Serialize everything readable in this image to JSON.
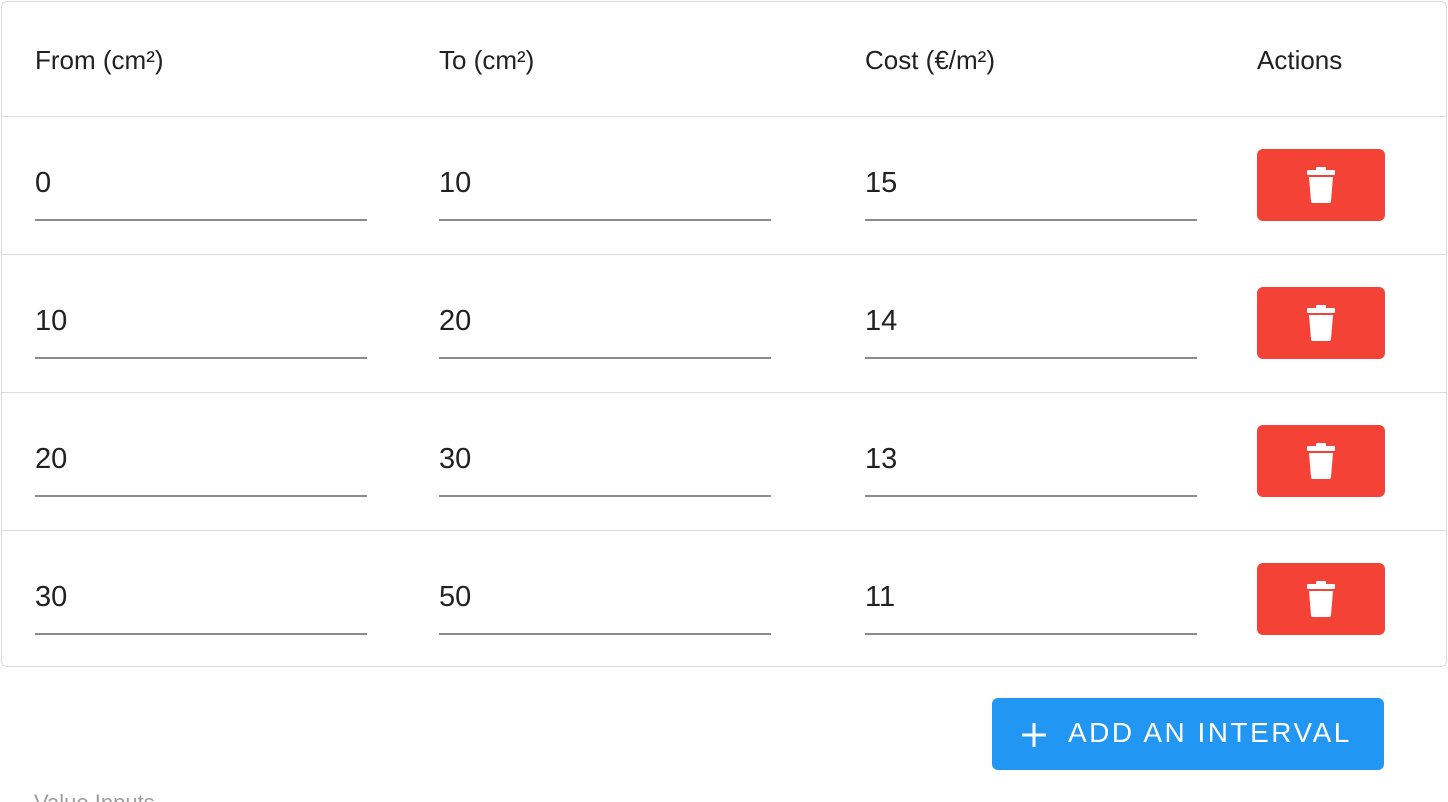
{
  "table": {
    "headers": {
      "from": "From (cm²)",
      "to": "To (cm²)",
      "cost": "Cost (€/m²)",
      "actions": "Actions"
    },
    "rows": [
      {
        "from": "0",
        "to": "10",
        "cost": "15"
      },
      {
        "from": "10",
        "to": "20",
        "cost": "14"
      },
      {
        "from": "20",
        "to": "30",
        "cost": "13"
      },
      {
        "from": "30",
        "to": "50",
        "cost": "11"
      }
    ]
  },
  "add_button": {
    "label": "ADD AN INTERVAL",
    "icon": "plus-icon"
  },
  "row_action": {
    "icon": "trash-icon"
  },
  "footer": {
    "hint": "Value Inputs"
  },
  "colors": {
    "delete": "#f44336",
    "primary": "#2196f3",
    "divider": "#dcdcdc",
    "underline": "#8c8c8c"
  }
}
